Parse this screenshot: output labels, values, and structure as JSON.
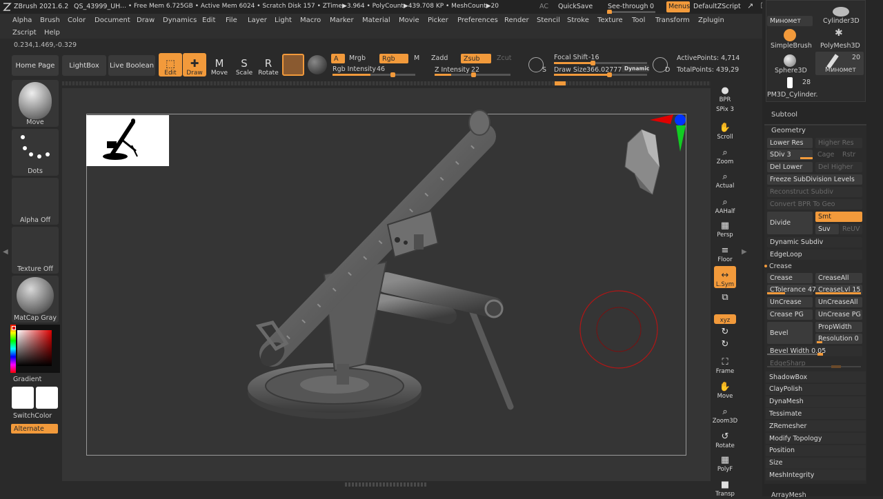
{
  "titlebar": {
    "app": "ZBrush 2021.6.2",
    "doc": "QS_43999_UH",
    "stats": "… • Free Mem 6.725GB • Active Mem 6024 • Scratch Disk 157 •  ZTime▶3.964 • PolyCount▶439.708 KP •  MeshCount▶20",
    "ac": "AC",
    "quicksave": "QuickSave",
    "see_through_label": "See-through",
    "see_through_value": "0",
    "menus": "Menus",
    "script": "DefaultZScript",
    "window_icons": [
      "↗",
      "❐",
      "↕",
      "⇆",
      "▣",
      "—",
      "□",
      "✕"
    ]
  },
  "menu": {
    "row1": [
      "Alpha",
      "Brush",
      "Color",
      "Document",
      "Draw",
      "Dynamics",
      "Edit",
      "File",
      "Layer",
      "Light",
      "Macro",
      "Marker",
      "Material",
      "Movie",
      "Picker",
      "Preferences",
      "Render",
      "Stencil",
      "Stroke",
      "Texture",
      "Tool",
      "Transform",
      "Zplugin"
    ],
    "row2": [
      "Zscript",
      "Help"
    ]
  },
  "coords": "0.234,1.469,-0.329",
  "shelf": {
    "home": "Home Page",
    "lightbox": "LightBox",
    "live_boolean": "Live Boolean",
    "tools": [
      {
        "label": "Edit",
        "icon": "edit-icon",
        "glyph": "⬚",
        "on": true
      },
      {
        "label": "Draw",
        "icon": "draw-icon",
        "glyph": "✚",
        "on": true
      },
      {
        "label": "Move",
        "icon": "move-icon",
        "glyph": "M",
        "on": false
      },
      {
        "label": "Scale",
        "icon": "scale-icon",
        "glyph": "S",
        "on": false
      },
      {
        "label": "Rotate",
        "icon": "rotate-icon",
        "glyph": "R",
        "on": false
      }
    ],
    "a_label": "A",
    "mrgb": "Mrgb",
    "rgb": "Rgb",
    "m": "M",
    "zadd": "Zadd",
    "zsub": "Zsub",
    "zcut": "Zcut",
    "rgb_intensity_label": "Rgb Intensity",
    "rgb_intensity": "46",
    "z_intensity_label": "Z Intensity",
    "z_intensity": "22",
    "focal_shift_label": "Focal Shift",
    "focal_shift": "-16",
    "draw_size_label": "Draw Size",
    "draw_size": "366.02777",
    "dynamic": "Dynamic",
    "active_points": "ActivePoints: 4,714",
    "total_points": "TotalPoints: 439,29",
    "s_label": "S",
    "d_label": "D"
  },
  "left": {
    "brush": "Move",
    "stroke": "Dots",
    "alpha": "Alpha Off",
    "texture": "Texture Off",
    "material": "MatCap Gray",
    "gradient": "Gradient",
    "switchcolor": "SwitchColor",
    "alternate": "Alternate"
  },
  "right_tools": [
    {
      "label": "BPR",
      "glyph": "●",
      "icon": "bpr-icon",
      "on": false
    },
    {
      "label": "SPix 3",
      "glyph": "",
      "icon": "spix-icon",
      "on": false
    },
    {
      "label": "Scroll",
      "glyph": "✋",
      "icon": "scroll-icon",
      "on": false
    },
    {
      "label": "Zoom",
      "glyph": "⌕",
      "icon": "zoom-icon",
      "on": false
    },
    {
      "label": "Actual",
      "glyph": "⌕",
      "icon": "actual-icon",
      "on": false
    },
    {
      "label": "AAHalf",
      "glyph": "⌕",
      "icon": "aahalf-icon",
      "on": false
    },
    {
      "label": "Persp",
      "glyph": "▦",
      "icon": "persp-icon",
      "on": false
    },
    {
      "label": "Floor",
      "glyph": "≡",
      "icon": "floor-icon",
      "on": false
    },
    {
      "label": "L.Sym",
      "glyph": "↔",
      "icon": "lsym-icon",
      "on": true
    },
    {
      "label": "",
      "glyph": "⧉",
      "icon": "lock-icon",
      "on": false
    },
    {
      "label": "xyz",
      "glyph": "",
      "icon": "xyz-icon",
      "on": true
    },
    {
      "label": "",
      "glyph": "↻",
      "icon": "rot-y-icon",
      "on": false
    },
    {
      "label": "",
      "glyph": "↻",
      "icon": "rot-z-icon",
      "on": false
    },
    {
      "label": "Frame",
      "glyph": "⛶",
      "icon": "frame-icon",
      "on": false
    },
    {
      "label": "Move",
      "glyph": "✋",
      "icon": "move-view-icon",
      "on": false
    },
    {
      "label": "Zoom3D",
      "glyph": "⌕",
      "icon": "zoom3d-icon",
      "on": false
    },
    {
      "label": "Rotate",
      "glyph": "↺",
      "icon": "rotate-view-icon",
      "on": false
    },
    {
      "label": "PolyF",
      "glyph": "▦",
      "icon": "polyf-icon",
      "on": false
    },
    {
      "label": "Transp",
      "glyph": "■",
      "icon": "transp-icon",
      "on": false
    }
  ],
  "panel": {
    "minomet_top": "Миномет",
    "cylinder3d": "Cylinder3D",
    "simplebrush": "SimpleBrush",
    "polymesh3d": "PolyMesh3D",
    "sphere3d": "Sphere3D",
    "minomet": "Миномет",
    "minomet_count": "20",
    "pm3d": "PM3D_Cylinder.",
    "pm3d_count": "28",
    "subtool": "Subtool",
    "geometry": "Geometry",
    "lower_res": "Lower Res",
    "higher_res": "Higher Res",
    "sdiv": "SDiv 3",
    "cage": "Cage",
    "rstr": "Rstr",
    "del_lower": "Del Lower",
    "del_higher": "Del Higher",
    "freeze": "Freeze SubDivision Levels",
    "reconstruct": "Reconstruct Subdiv",
    "convert_bpr": "Convert BPR To Geo",
    "divide": "Divide",
    "smt": "Smt",
    "suv": "Suv",
    "reuv": "ReUV",
    "dynamic_subdiv": "Dynamic Subdiv",
    "edgeloop": "EdgeLoop",
    "crease_header": "Crease",
    "crease": "Crease",
    "creaseall": "CreaseAll",
    "ctolerance": "CTolerance 47",
    "creaselvl": "CreaseLvl 15",
    "uncrease": "UnCrease",
    "uncreaseall": "UnCreaseAll",
    "crease_pg": "Crease PG",
    "uncrease_pg": "UnCrease PG",
    "bevel": "Bevel",
    "propwidth": "PropWidth",
    "resolution": "Resolution 0",
    "bevel_width": "Bevel Width 0.05",
    "edgesharp": "EdgeSharp",
    "list": [
      "ShadowBox",
      "ClayPolish",
      "DynaMesh",
      "Tessimate",
      "ZRemesher",
      "Modify Topology",
      "Position",
      "Size",
      "MeshIntegrity"
    ],
    "arraymesh": "ArrayMesh"
  },
  "colors": {
    "accent": "#f29a3b",
    "bg": "#2a2a2a",
    "canvas": "#353535",
    "model": "#6e6e6e",
    "cursor_ring": "#b31515"
  }
}
